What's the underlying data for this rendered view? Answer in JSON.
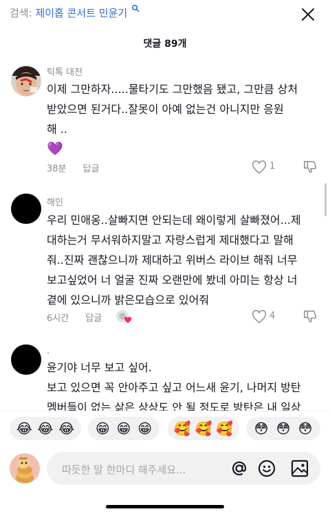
{
  "search": {
    "prefix": "검색:",
    "query": "제이홉 콘서트 민윤기"
  },
  "comments_header": {
    "count_label": "댓글 89개"
  },
  "comments": [
    {
      "author": "틱톡 대전",
      "lines": [
        "이제 그만하자.....물타기도 그만했음 됐고, 그만큼 상처",
        "받았으면 된거다..잘못이 아예 없는건 아니지만 응원",
        "해 ..",
        "💜"
      ],
      "time": "38분",
      "reply": "답글",
      "likes": "1"
    },
    {
      "author": "해인",
      "lines": [
        "우리 민애옹..살빠지면 안되는데 왜이렇게 살빠졌어...제",
        "대하는거 무서워하지말고 자랑스럽게 제대했다고 말해",
        "줘..진짜 괜찮으니까 제대하고 위버스 라이브 해줘 너무",
        "보고싶었어 너 얼굴 진짜 오랜만에 봤네 아미는 항상 너",
        "곁에 있으니까 밝은모습으로 있어줘"
      ],
      "time": "6시간",
      "reply": "답글",
      "likes": "4"
    },
    {
      "author": ".",
      "lines": [
        "윤기야 너무 보고 싶어.",
        "보고 있으면 꼭 안아주고 싶고 어느새 윤기, 나머지 방탄",
        "멤버들이 없는 삶은 상상도 안 될 정도로 방탄은 내 일상"
      ]
    }
  ],
  "emoji_bar": [
    [
      "😂",
      "😂",
      "😂"
    ],
    [
      "😁",
      "😁",
      "😁"
    ],
    [
      "🥰",
      "🥰",
      "🥰"
    ],
    [
      "😳",
      "😳",
      "😳"
    ]
  ],
  "composer": {
    "placeholder": "따듯한 말 한마디 해주세요..."
  }
}
